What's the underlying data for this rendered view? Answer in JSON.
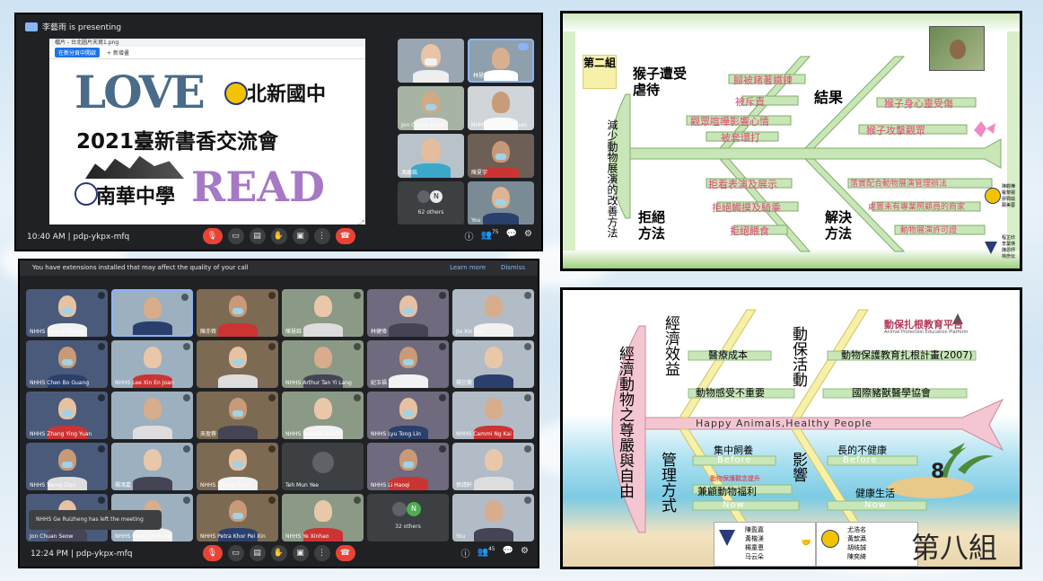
{
  "meet1": {
    "presenting": "李藝雨 is presenting",
    "time": "10:40 AM",
    "sep": "|",
    "code": "pdp-ykpx-mfq",
    "viewer_tab": "檔片 - 台北圖片天寫1.png",
    "viewer_btn1": "在新分頁中開啟",
    "viewer_btn2": "+ 新增畫",
    "share_big": "LOVE",
    "share_school1": "北新國中",
    "share_title": "2021臺新書香交流會",
    "share_school2": "南華中學",
    "share_read": "READ",
    "tiles": [
      "",
      "林慧錦",
      "Jon Chuan Seow",
      "NHHS Zhang Yuxuan",
      "馮繼銘",
      "陳夏宇",
      "62 others",
      "You"
    ],
    "others_initial": "N",
    "participants": "75"
  },
  "meet2": {
    "warning": "You have extensions installed that may affect the quality of your call",
    "learn_more": "Learn more",
    "dismiss": "Dismiss",
    "time": "12:24 PM",
    "sep": "|",
    "code": "pdp-ykpx-mfq",
    "toast": "NHHS Ge Ruizheng has left the meeting",
    "others_count": "32 others",
    "others_initial": "N",
    "participants": "45",
    "tiles": [
      "NHHS Huang Misoqi",
      "",
      "陳亦齊",
      "陳慧鈺",
      "林健偉",
      "Jia Xin Koh",
      "NHHS Chen Bo Guang",
      "NHHS Lee Xin En Joan",
      "",
      "NHHS Arthur Tan Yi Lang",
      "紀玉福",
      "楊宜蓁",
      "NHHS Zhang Ying Yuan",
      "",
      "吳盈蓉",
      "NHHS Isabelle Koh Y",
      "NHHS Lyu Tong Lin",
      "NHHS Cammi Ng Kai",
      "NHHS Wang Ziyu",
      "楊鴻嘉",
      "NHHS Zhang Yuxin",
      "Teh Mun Yee",
      "NHHS Li Haoqi",
      "張靖軒",
      "Jon Chuan Seow",
      "NHHS Chan Chee Yan",
      "NHHS Petra Khor Pei Xin",
      "NHHS Ye Xinhao",
      "32 others",
      "You"
    ],
    "teh_initial": ""
  },
  "slide1": {
    "group": "第二組",
    "spine_label": "減少動物展演的改善方法",
    "cat1": "猴子遭受虐待",
    "cat2": "結果",
    "cat3": "拒絕方法",
    "cat4": "解決方法",
    "items_top": [
      "腳被鍺著鐵鍊",
      "被斥責",
      "觀眾喧嘩影響心情",
      "被套環打"
    ],
    "items_result": [
      "猴子身心靈受傷",
      "猴子攻擊觀眾"
    ],
    "items_reject": [
      "拒看表演及展示",
      "拒絕觸摸及騎乘",
      "拒絕餵食"
    ],
    "items_solve": [
      "落實配合動物展演管理辦法",
      "處置未有專業照顧員的商家",
      "動物展演許可證"
    ],
    "names1": [
      "陳觀樺",
      "羅黎揚",
      "廖珮瑜",
      "鄭美蓉"
    ],
    "names2": [
      "程芷欣",
      "李葉瑛",
      "陳恩妤",
      "林彦伝"
    ]
  },
  "slide2": {
    "spine_label": "經濟動物之尊嚴與自由",
    "cat1": "經濟效益",
    "cat2": "動保活動",
    "cat3": "管理方式",
    "cat4": "影響",
    "brand": "動保扎根教育平台",
    "brand_sub": "Animal Protection Education Platform",
    "spine_text": "Happy Animals,Healthy People",
    "item_a1": "醫療成本",
    "item_a2": "動物感受不重要",
    "item_b1": "動物保護教育扎根計畫(2007)",
    "item_b2": "國際豬獸醫學協會",
    "item_c1": "集中飼養",
    "item_c_before": "Before",
    "item_c2": "動物保護觀念提升",
    "item_c3": "兼顧動物福利",
    "item_c_now": "Now",
    "item_d1": "長的不健康",
    "item_d_before": "Before",
    "item_d2": "健康生活",
    "item_d_now": "Now",
    "names1": [
      "陳盈嘉",
      "黃楷渼",
      "楊童恩",
      "马云朵"
    ],
    "names2": [
      "尤浩名",
      "黃歆瀛",
      "胡岐誠",
      "陳奕綺"
    ],
    "group": "第八組",
    "num": "8"
  },
  "colors": {
    "meet_bg": "#202124",
    "end_call": "#ea4335",
    "slide_green": "#c8e6b8",
    "slide_yellow": "#f7f0a8",
    "spine_pink": "#f3c6d2",
    "link_blue": "#8ab4f8"
  }
}
